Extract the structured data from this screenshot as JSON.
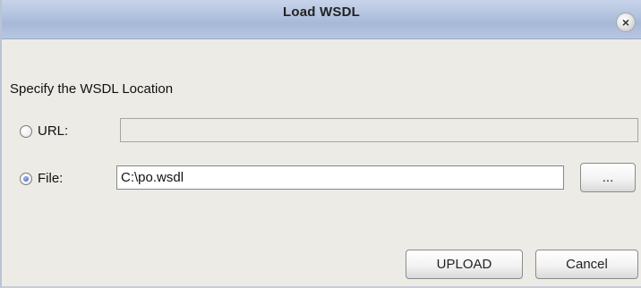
{
  "dialog": {
    "title": "Load WSDL",
    "close_glyph": "×",
    "close_icon": "close-icon"
  },
  "form": {
    "heading": "Specify the WSDL Location",
    "url_label": "URL:",
    "url_value": "",
    "url_selected": false,
    "file_label": "File:",
    "file_value": "C:\\po.wsdl",
    "file_selected": true,
    "browse_label": "..."
  },
  "buttons": {
    "upload": "UPLOAD",
    "cancel": "Cancel"
  },
  "colors": {
    "titlebar": "#b3c3df",
    "background": "#ecebe6",
    "radio_accent": "#5c74d3"
  }
}
